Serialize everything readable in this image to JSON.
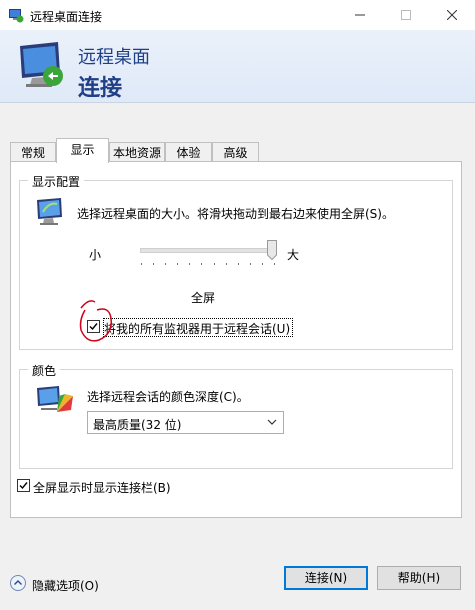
{
  "window": {
    "title": "远程桌面连接"
  },
  "banner": {
    "line1": "远程桌面",
    "line2": "连接"
  },
  "tabs": [
    {
      "label": "常规"
    },
    {
      "label": "显示"
    },
    {
      "label": "本地资源"
    },
    {
      "label": "体验"
    },
    {
      "label": "高级"
    }
  ],
  "display_config": {
    "legend": "显示配置",
    "description": "选择远程桌面的大小。将滑块拖动到最右边来使用全屏(S)。",
    "min_label": "小",
    "max_label": "大",
    "size_value": "全屏",
    "slider_level": 1.0,
    "all_monitors_label": "将我的所有监视器用于远程会话(U)",
    "all_monitors_checked": true
  },
  "colors": {
    "legend": "颜色",
    "description": "选择远程会话的颜色深度(C)。",
    "selected": "最高质量(32 位)"
  },
  "connection_bar": {
    "label": "全屏显示时显示连接栏(B)",
    "checked": true
  },
  "footer": {
    "hide_options": "隐藏选项(O)",
    "connect": "连接(N)",
    "help": "帮助(H)"
  },
  "annotation": {
    "color": "#d0021b"
  },
  "accent": "#0078d7"
}
